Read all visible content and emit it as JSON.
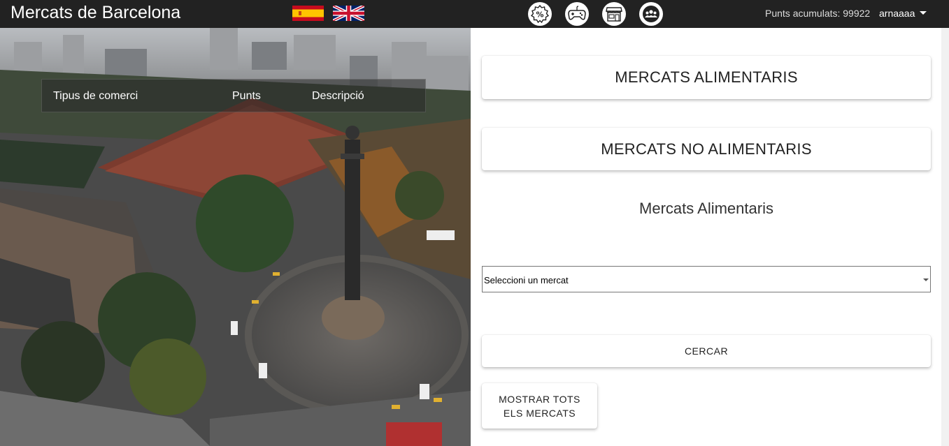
{
  "header": {
    "title": "Mercats de Barcelona",
    "flags": [
      {
        "name": "spain-flag-icon"
      },
      {
        "name": "uk-flag-icon"
      }
    ],
    "nav_icons": [
      "discount-icon",
      "gamepad-icon",
      "store-icon",
      "community-icon"
    ],
    "points_text": "Punts acumulats: 99922",
    "username": "arnaaaa"
  },
  "hero": {
    "nav": [
      "Tipus de comerci",
      "Punts",
      "Descripció"
    ]
  },
  "main": {
    "category_buttons": [
      "MERCATS ALIMENTARIS",
      "MERCATS NO ALIMENTARIS"
    ],
    "section_title": "Mercats Alimentaris",
    "select_value": "Seleccioni un mercat",
    "search_button": "CERCAR",
    "show_all_button": "MOSTRAR TOTS ELS MERCATS"
  },
  "colors": {
    "topbar": "#222222",
    "accent": "#ffffff"
  }
}
